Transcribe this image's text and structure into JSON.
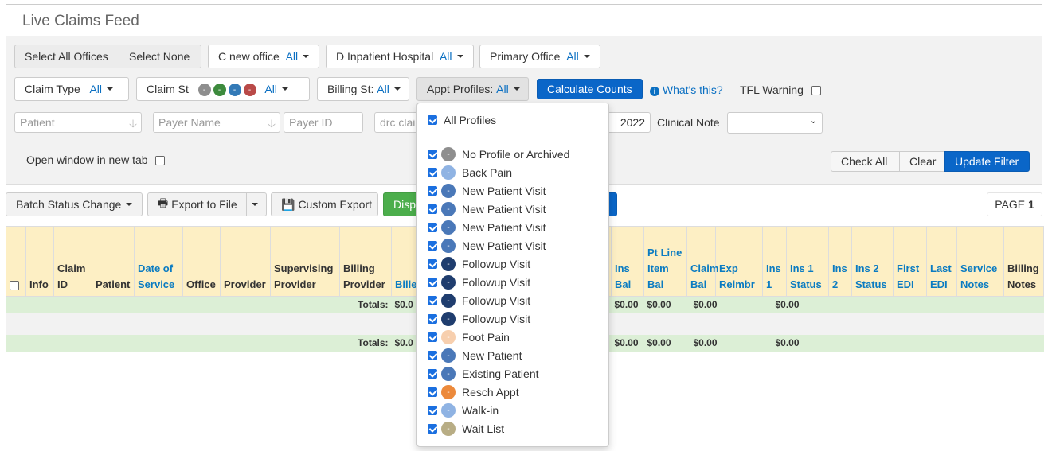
{
  "title": "Live Claims Feed",
  "filters": {
    "select_all_offices": "Select All Offices",
    "select_none": "Select None",
    "offices": [
      {
        "label": "C new office",
        "value": "All"
      },
      {
        "label": "D Inpatient Hospital",
        "value": "All"
      },
      {
        "label": "Primary Office",
        "value": "All"
      }
    ],
    "claim_type": {
      "label": "Claim Type",
      "value": "All"
    },
    "claim_st": {
      "label": "Claim St",
      "value": "All",
      "dots": [
        {
          "text": "-",
          "color": "#8e8e8e"
        },
        {
          "text": "-",
          "color": "#3d8b3d"
        },
        {
          "text": "-",
          "color": "#337ab7"
        },
        {
          "text": "-",
          "color": "#b94a48"
        }
      ]
    },
    "billing_st": {
      "label": "Billing St:",
      "value": "All"
    },
    "appt_profiles": {
      "label": "Appt Profiles:",
      "value": "All"
    },
    "calculate_counts": "Calculate Counts",
    "whats_this": "What's this?",
    "tfl_warning": "TFL Warning",
    "patient_placeholder": "Patient",
    "payer_name_placeholder": "Payer Name",
    "payer_id_placeholder": "Payer ID",
    "drc_placeholder": "drc clair",
    "date_value": "2022",
    "clinical_note": "Clinical Note",
    "open_new_tab": "Open window in new tab",
    "check_all": "Check All",
    "clear": "Clear",
    "update_filter": "Update Filter"
  },
  "toolbar": {
    "batch_status": "Batch Status Change",
    "export_file": "Export to File",
    "custom_export": "Custom Export",
    "display": "Displ",
    "page_label": "PAGE",
    "page_number": "1"
  },
  "table": {
    "headers": [
      {
        "text": "",
        "link": false
      },
      {
        "text": "Info",
        "link": false
      },
      {
        "text": "Claim ID",
        "link": false
      },
      {
        "text": "Patient",
        "link": false
      },
      {
        "text": "Date of Service",
        "link": true
      },
      {
        "text": "Office",
        "link": false
      },
      {
        "text": "Provider",
        "link": false
      },
      {
        "text": "Supervising Provider",
        "link": false
      },
      {
        "text": "Billing Provider",
        "link": false
      },
      {
        "text": "Billed",
        "link": true
      },
      {
        "text": "Ins Bal",
        "link": true
      },
      {
        "text": "Pt Line Item Bal",
        "link": true
      },
      {
        "text": "Claim Bal",
        "link": true
      },
      {
        "text": "Exp Reimbr",
        "link": true
      },
      {
        "text": "Ins 1",
        "link": true
      },
      {
        "text": "Ins 1 Status",
        "link": true
      },
      {
        "text": "Ins 2",
        "link": true
      },
      {
        "text": "Ins 2 Status",
        "link": true
      },
      {
        "text": "First EDI",
        "link": true
      },
      {
        "text": "Last EDI",
        "link": true
      },
      {
        "text": "Service Notes",
        "link": true
      },
      {
        "text": "Billing Notes",
        "link": false
      }
    ],
    "totals_label": "Totals:",
    "totals": [
      "$0.0",
      "$0.00",
      "$0.00",
      "$0.00",
      "$0.00"
    ]
  },
  "dropdown": {
    "all_profiles": "All Profiles",
    "items": [
      {
        "label": "No Profile or Archived",
        "color": "#8e8e8e"
      },
      {
        "label": "Back Pain",
        "color": "#8fb3e3"
      },
      {
        "label": "New Patient Visit",
        "color": "#4a78b8"
      },
      {
        "label": "New Patient Visit",
        "color": "#4a78b8"
      },
      {
        "label": "New Patient Visit",
        "color": "#4a78b8"
      },
      {
        "label": "New Patient Visit",
        "color": "#4a78b8"
      },
      {
        "label": "Followup Visit",
        "color": "#1f3d6e"
      },
      {
        "label": "Followup Visit",
        "color": "#1f3d6e"
      },
      {
        "label": "Followup Visit",
        "color": "#1f3d6e"
      },
      {
        "label": "Followup Visit",
        "color": "#1f3d6e"
      },
      {
        "label": "Foot Pain",
        "color": "#f7cfae"
      },
      {
        "label": "New Patient",
        "color": "#4a78b8"
      },
      {
        "label": "Existing Patient",
        "color": "#4a78b8"
      },
      {
        "label": "Resch Appt",
        "color": "#ec8a3c"
      },
      {
        "label": "Walk-in",
        "color": "#8fb3e3"
      },
      {
        "label": "Wait List",
        "color": "#b8ad85"
      }
    ]
  }
}
